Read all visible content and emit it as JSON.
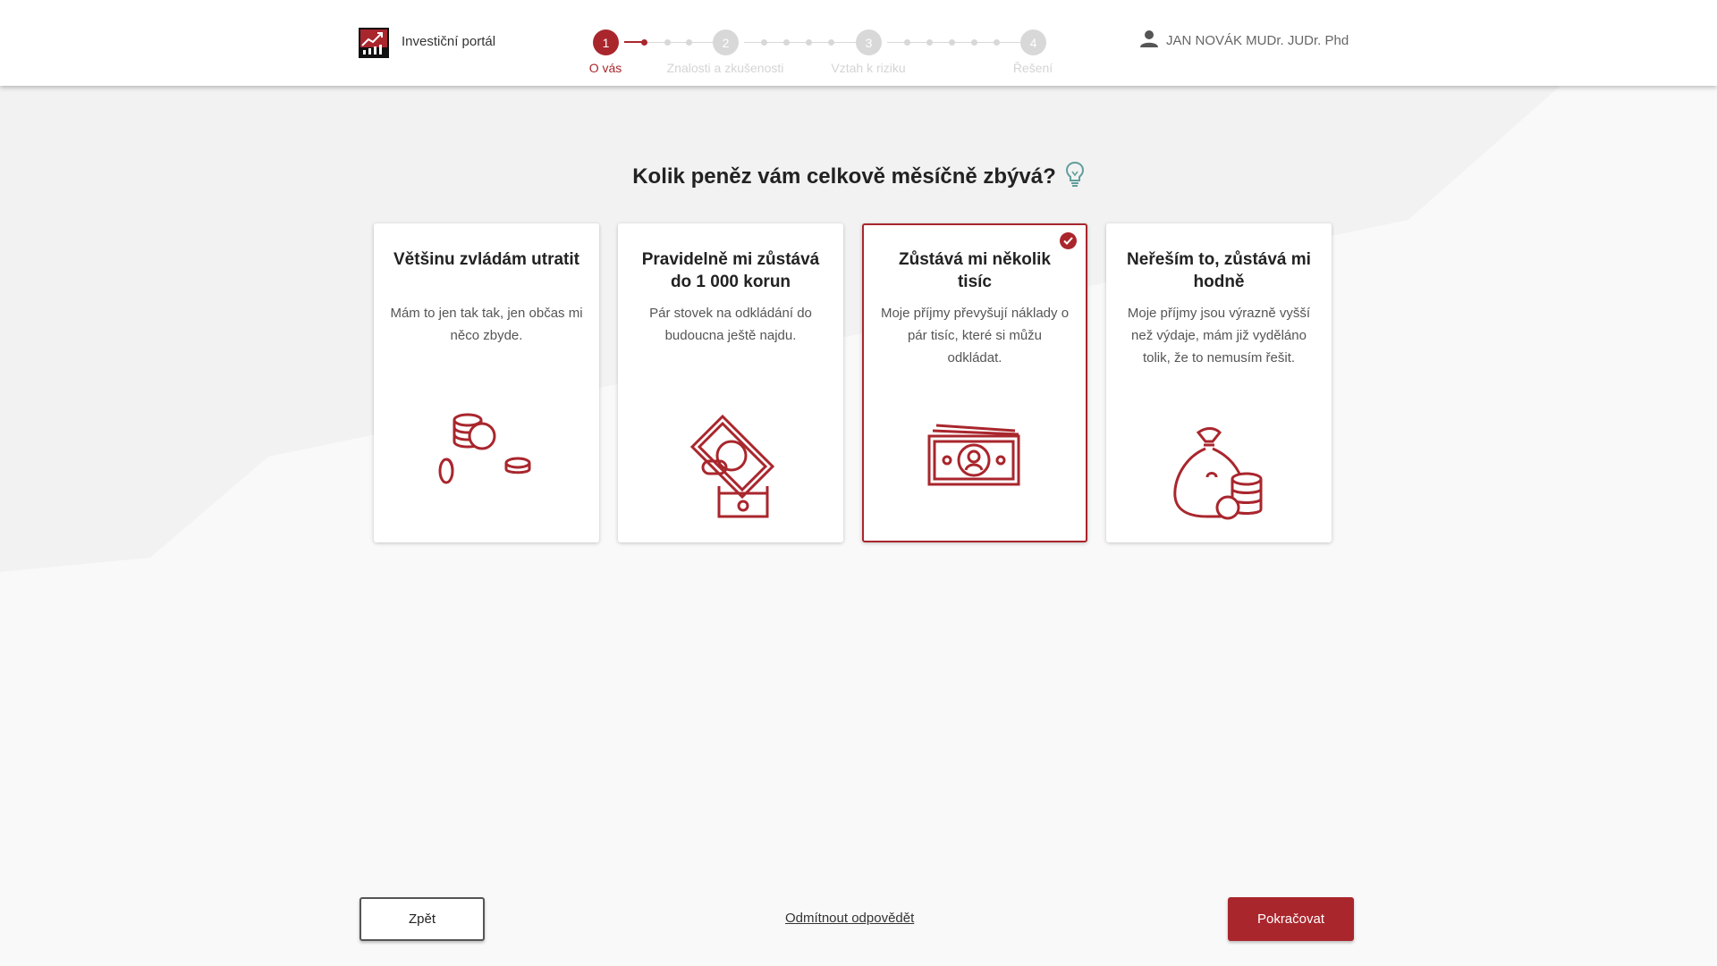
{
  "header": {
    "brand": "Investiční portál",
    "user_name": "JAN NOVÁK MUDr. JUDr. Phd",
    "steps": [
      {
        "number": "1",
        "label": "O vás",
        "active": true
      },
      {
        "number": "2",
        "label": "Znalosti a zkušenosti",
        "active": false
      },
      {
        "number": "3",
        "label": "Vztah k riziku",
        "active": false
      },
      {
        "number": "4",
        "label": "Řešení",
        "active": false
      }
    ]
  },
  "main": {
    "question": "Kolik peněz vám celkově měsíčně zbývá?",
    "options": [
      {
        "title": "Většinu zvládám utratit",
        "description": "Mám to jen tak tak, jen občas mi něco zbyde.",
        "icon": "coins-icon",
        "selected": false
      },
      {
        "title": "Pravidelně mi zůstává do 1 000 korun",
        "description": "Pár stovek na odkládání do budoucna ještě najdu.",
        "icon": "banknote-hand-icon",
        "selected": false
      },
      {
        "title": "Zůstává mi několik tisíc",
        "description": "Moje příjmy převyšují náklady o pár tisíc, které si můžu odkládat.",
        "icon": "banknotes-stack-icon",
        "selected": true
      },
      {
        "title": "Neřeším to, zůstává mi hodně",
        "description": "Moje příjmy jsou výrazně vyšší než výdaje, mám již vyděláno tolik, že to nemusím řešit.",
        "icon": "money-bag-icon",
        "selected": false
      }
    ]
  },
  "footer": {
    "back_label": "Zpět",
    "decline_label": "Odmítnout odpovědět",
    "next_label": "Pokračovat"
  },
  "colors": {
    "accent": "#a9262d",
    "inactive_step": "#d8d8d8",
    "background": "#f9f9f9"
  }
}
